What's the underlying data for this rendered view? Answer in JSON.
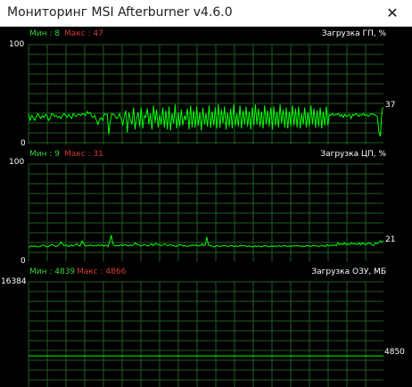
{
  "window": {
    "title": "Мониторинг MSI Afterburner v4.6.0",
    "close_icon": "close-icon"
  },
  "graphs": [
    {
      "name": "Загрузка ГП, %",
      "min_label": "Мин : 8",
      "max_label": "Макс : 47",
      "y_top": "100",
      "y_bottom": "0",
      "current": "37",
      "values": [
        31,
        24,
        29,
        27,
        24,
        28,
        31,
        28,
        26,
        29,
        27,
        30,
        29,
        24,
        26,
        31,
        30,
        28,
        29,
        27,
        28,
        26,
        29,
        31,
        29,
        27,
        30,
        28,
        26,
        31,
        29,
        28,
        30,
        30,
        29,
        31,
        30,
        29,
        33,
        31,
        32,
        28,
        27,
        29,
        24,
        20,
        25,
        27,
        24,
        31,
        30,
        30,
        10,
        24,
        31,
        30,
        29,
        26,
        27,
        31,
        26,
        19,
        28,
        34,
        12,
        32,
        25,
        20,
        37,
        15,
        26,
        32,
        18,
        37,
        16,
        29,
        27,
        36,
        20,
        31,
        15,
        39,
        22,
        35,
        17,
        30,
        20,
        37,
        17,
        34,
        15,
        38,
        14,
        31,
        21,
        40,
        16,
        32,
        18,
        35,
        19,
        29,
        24,
        36,
        15,
        39,
        17,
        34,
        17,
        38,
        19,
        32,
        14,
        37,
        20,
        31,
        18,
        39,
        17,
        33,
        19,
        37,
        16,
        40,
        17,
        35,
        21,
        38,
        15,
        32,
        18,
        36,
        16,
        40,
        19,
        31,
        18,
        39,
        16,
        34,
        20,
        38,
        18,
        33,
        15,
        37,
        19,
        40,
        20,
        36,
        18,
        33,
        16,
        39,
        20,
        34,
        18,
        37,
        15,
        38,
        19,
        33,
        17,
        40,
        21,
        35,
        17,
        37,
        16,
        33,
        18,
        39,
        19,
        36,
        17,
        38,
        16,
        31,
        20,
        37,
        17,
        32,
        18,
        39,
        20,
        36,
        17,
        34,
        18,
        37,
        16,
        33,
        19,
        38,
        19,
        30,
        29,
        31,
        29,
        30,
        30,
        31,
        28,
        30,
        27,
        30,
        28,
        29,
        30,
        26,
        30,
        29,
        31,
        30,
        28,
        30,
        29,
        31,
        29,
        30,
        28,
        29,
        31,
        30,
        30,
        29,
        28,
        13,
        8,
        35,
        37
      ]
    },
    {
      "name": "Загрузка ЦП, %",
      "min_label": "Мин : 9",
      "max_label": "Макс : 31",
      "y_top": "100",
      "y_bottom": "0",
      "current": "21",
      "values": [
        15,
        15,
        16,
        15,
        16,
        15,
        15,
        15,
        16,
        17,
        16,
        15,
        15,
        16,
        17,
        17,
        16,
        15,
        16,
        17,
        20,
        18,
        16,
        17,
        16,
        15,
        17,
        16,
        16,
        17,
        18,
        16,
        16,
        21,
        18,
        16,
        16,
        16,
        17,
        16,
        16,
        16,
        16,
        17,
        16,
        17,
        16,
        16,
        17,
        15,
        20,
        27,
        18,
        16,
        16,
        16,
        16,
        17,
        16,
        17,
        17,
        16,
        16,
        17,
        16,
        17,
        19,
        17,
        17,
        16,
        16,
        17,
        17,
        16,
        16,
        17,
        18,
        16,
        18,
        18,
        17,
        17,
        16,
        17,
        18,
        17,
        16,
        17,
        17,
        16,
        16,
        15,
        16,
        17,
        17,
        16,
        16,
        16,
        15,
        16,
        16,
        17,
        16,
        17,
        16,
        16,
        16,
        18,
        16,
        17,
        25,
        17,
        16,
        16,
        15,
        15,
        16,
        16,
        15,
        16,
        16,
        16,
        16,
        15,
        16,
        16,
        16,
        15,
        16,
        15,
        16,
        16,
        16,
        16,
        16,
        15,
        16,
        15,
        15,
        15,
        16,
        15,
        16,
        15,
        15,
        16,
        16,
        16,
        15,
        15,
        16,
        15,
        16,
        15,
        16,
        16,
        15,
        16,
        16,
        16,
        15,
        16,
        15,
        16,
        16,
        16,
        16,
        16,
        15,
        16,
        15,
        16,
        16,
        16,
        15,
        16,
        16,
        16,
        16,
        15,
        16,
        16,
        16,
        15,
        17,
        16,
        16,
        17,
        16,
        17,
        16,
        19,
        17,
        18,
        17,
        19,
        17,
        18,
        17,
        19,
        18,
        18,
        18,
        17,
        19,
        17,
        19,
        18,
        17,
        18,
        19,
        18,
        17,
        16,
        19,
        18,
        19,
        21,
        20,
        21
      ]
    },
    {
      "name": "Загрузка ОЗУ, МБ",
      "min_label": "Мин : 4839",
      "max_label": "Макс : 4866",
      "y_top": "16384",
      "y_bottom": "",
      "current": "4850",
      "values": [
        4842,
        4842,
        4842,
        4842,
        4842,
        4842,
        4842,
        4842,
        4842,
        4842,
        4843,
        4843,
        4844,
        4844,
        4843,
        4843,
        4844,
        4845,
        4846,
        4847,
        4848,
        4849,
        4849,
        4848,
        4847,
        4846,
        4846,
        4847,
        4848,
        4849,
        4849,
        4848,
        4848,
        4847,
        4848,
        4849,
        4850,
        4850,
        4850,
        4850,
        4850,
        4850,
        4850,
        4850,
        4850,
        4849,
        4849,
        4849,
        4850,
        4850
      ]
    }
  ],
  "colors": {
    "line": "#00ff00",
    "grid": "#1f5b25",
    "min": "#36d63a",
    "max": "#d63a36"
  }
}
